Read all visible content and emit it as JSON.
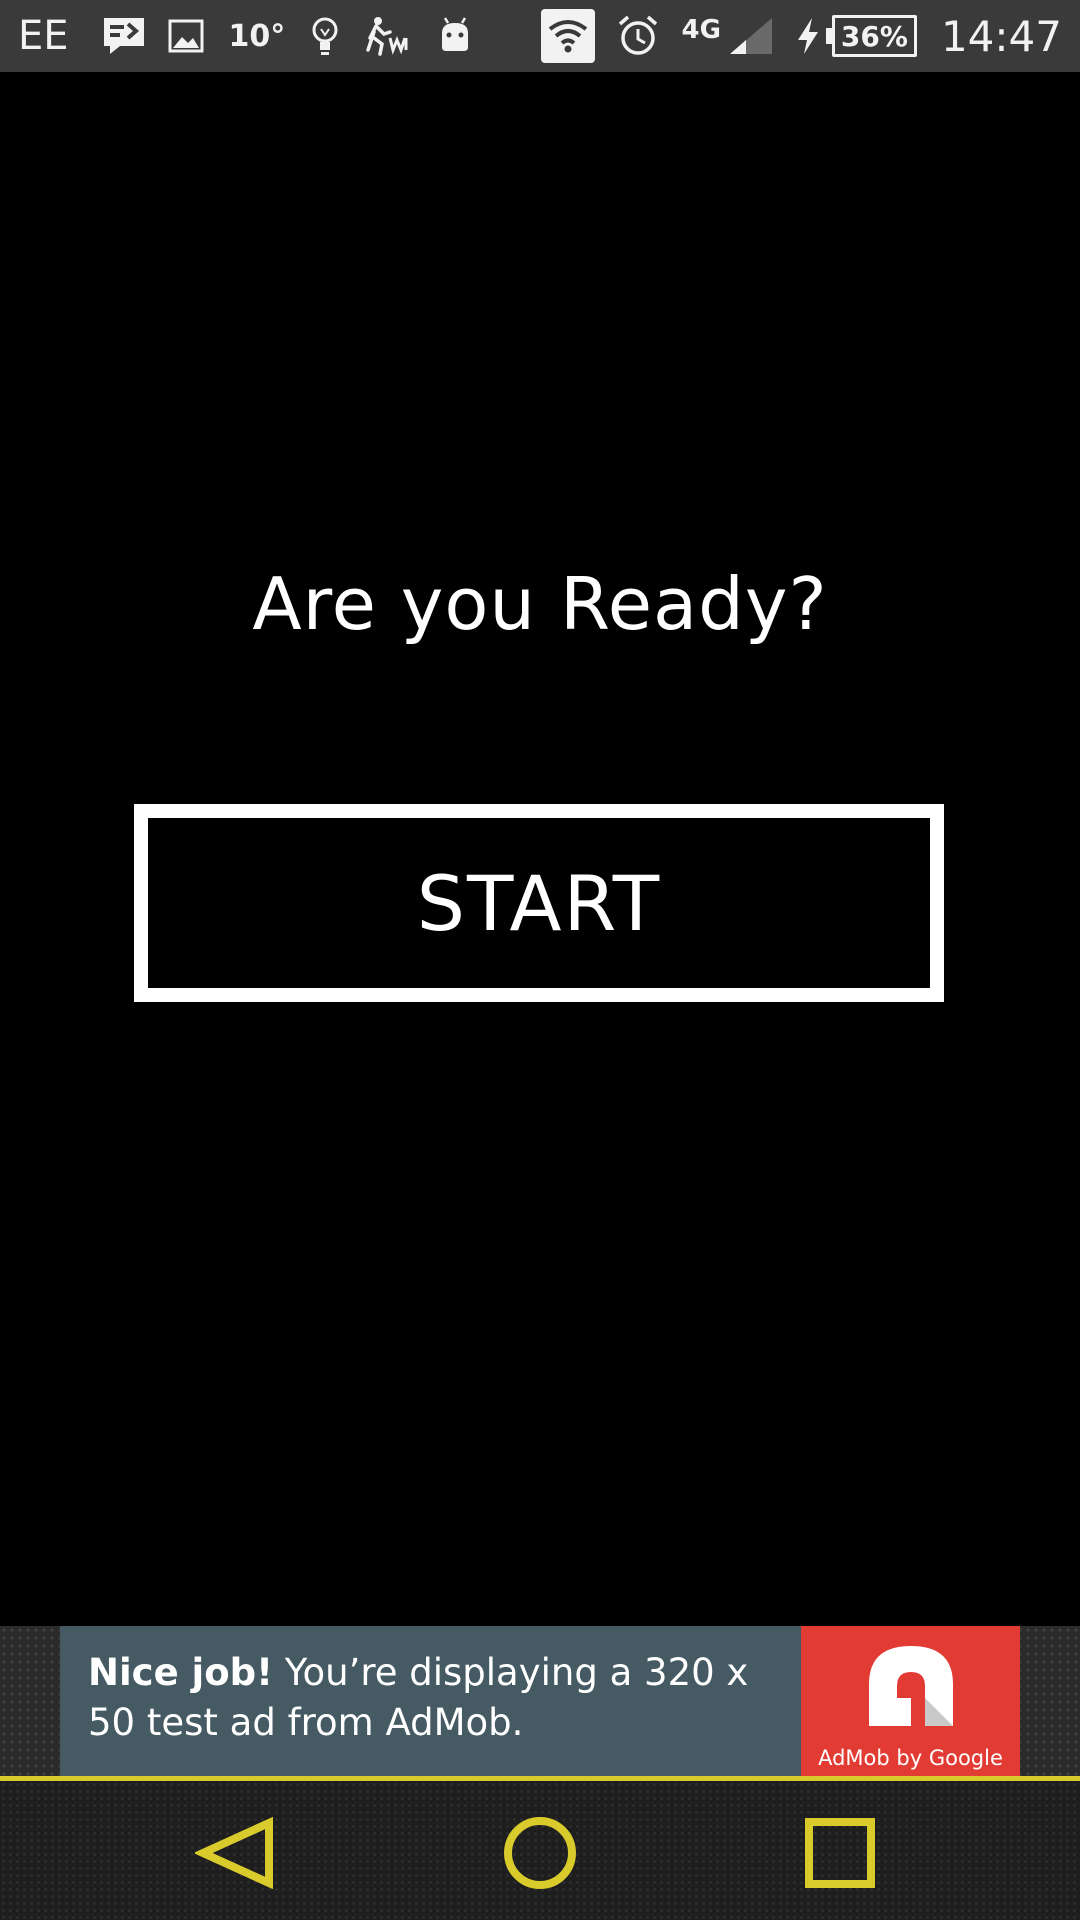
{
  "status_bar": {
    "carrier": "EE",
    "temperature": "10°",
    "network_type": "4G",
    "battery": "36%",
    "time": "14:47",
    "icons": [
      "message-icon",
      "gallery-icon",
      "bulb-icon",
      "running-app-icon",
      "android-icon",
      "wifi-icon",
      "alarm-icon",
      "signal-icon",
      "charging-icon"
    ]
  },
  "main": {
    "prompt": "Are you Ready?",
    "start_label": "START"
  },
  "ad": {
    "headline": "Nice job!",
    "body": " You’re displaying a 320 x 50 test ad from AdMob.",
    "brand": "AdMob by Google",
    "colors": {
      "text_panel": "#465a64",
      "logo_panel": "#e23b34"
    }
  },
  "nav_bar": {
    "accent_color": "#d9cb2c",
    "buttons": [
      "back-icon",
      "home-icon",
      "recents-icon"
    ]
  }
}
